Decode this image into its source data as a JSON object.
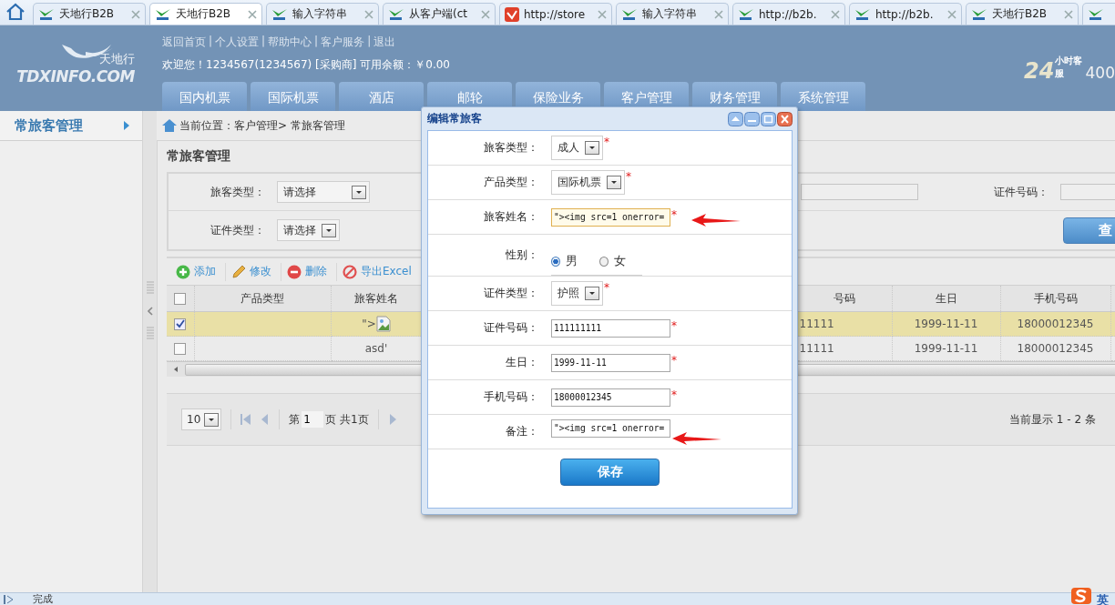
{
  "browser_tabs": [
    {
      "title": "天地行B2B",
      "selected": false
    },
    {
      "title": "天地行B2B",
      "selected": true
    },
    {
      "title": "输入字符串",
      "selected": false
    },
    {
      "title": "从客户端(ct",
      "selected": false
    },
    {
      "title": "http://store",
      "selected": false,
      "kind": "red"
    },
    {
      "title": "输入字符串",
      "selected": false
    },
    {
      "title": "http://b2b.",
      "selected": false
    },
    {
      "title": "http://b2b.",
      "selected": false
    },
    {
      "title": "天地行B2B",
      "selected": false
    },
    {
      "selected": false
    }
  ],
  "header": {
    "logo_text": "TDXINFO.COM",
    "logo_name": "天地行",
    "links": [
      "返回首页",
      "个人设置",
      "帮助中心",
      "客户服务",
      "退出"
    ],
    "link_separator": "|",
    "welcome": "欢迎您！1234567(1234567) [采购商] 可用余额：￥0.00",
    "hotline_mark": "24",
    "hotline_badge": "小时客服",
    "hotline_number": "400"
  },
  "nav_tabs": [
    {
      "label": "国内机票",
      "selected": false
    },
    {
      "label": "国际机票",
      "selected": false
    },
    {
      "label": "酒店",
      "selected": false
    },
    {
      "label": "邮轮",
      "selected": false
    },
    {
      "label": "保险业务",
      "selected": false
    },
    {
      "label": "客户管理",
      "selected": false
    },
    {
      "label": "财务管理",
      "selected": false
    },
    {
      "label": "系统管理",
      "selected": false
    }
  ],
  "sidebar": {
    "items": [
      {
        "label": "常旅客管理"
      }
    ]
  },
  "breadcrumb": "当前位置：客户管理> 常旅客管理",
  "panel_title": "常旅客管理",
  "filters": {
    "passenger_type": {
      "label": "旅客类型：",
      "value": "请选择"
    },
    "id_number": {
      "label": "证件号码："
    },
    "id_type": {
      "label": "证件类型：",
      "value": "请选择"
    },
    "search_button": "查"
  },
  "toolbar": [
    {
      "label": "添加",
      "kind": "add"
    },
    {
      "label": "修改",
      "kind": "edit"
    },
    {
      "label": "删除",
      "kind": "delete"
    },
    {
      "label": "导出Excel",
      "kind": "export"
    }
  ],
  "table": {
    "header_checked": false,
    "columns": [
      {
        "label": "产品类型"
      },
      {
        "label": "旅客姓名"
      },
      {
        "label": "号码"
      },
      {
        "label": "生日"
      },
      {
        "label": "手机号码"
      }
    ],
    "rows": [
      {
        "selected": true,
        "checked": true,
        "name_image": true,
        "cells": [
          "",
          "\">",
          "11111",
          "1999-11-11",
          "18000012345"
        ]
      },
      {
        "selected": false,
        "checked": false,
        "name_image": false,
        "cells": [
          "",
          "asd'",
          "11111",
          "1999-11-11",
          "18000012345"
        ]
      }
    ]
  },
  "pager": {
    "page_size": "10",
    "before": "第",
    "page": "1",
    "after": "页 共1页",
    "summary": "当前显示 1 - 2 条"
  },
  "dialog": {
    "title": "编辑常旅客",
    "required_mark": "*",
    "fields": [
      {
        "label": "旅客类型：",
        "kind": "select",
        "value": "成人",
        "required": true
      },
      {
        "label": "产品类型：",
        "kind": "select",
        "value": "国际机票",
        "required": true
      },
      {
        "label": "旅客姓名：",
        "kind": "input",
        "value": "\"><img src=1 onerror=",
        "required": true,
        "focused": true,
        "annotated": true
      },
      {
        "label": "性别：",
        "kind": "radio",
        "options": [
          {
            "label": "男",
            "selected": true
          },
          {
            "label": "女",
            "selected": false
          }
        ]
      },
      {
        "label": "证件类型：",
        "kind": "select",
        "value": "护照",
        "required": true
      },
      {
        "label": "证件号码：",
        "kind": "input",
        "value": "111111111",
        "required": true
      },
      {
        "label": "生日：",
        "kind": "input",
        "value": "1999-11-11",
        "required": true
      },
      {
        "label": "手机号码：",
        "kind": "input",
        "value": "18000012345",
        "required": true
      },
      {
        "label": "备注：",
        "kind": "input",
        "value": "\"><img src=1 onerror=",
        "required": false,
        "annotated": true
      }
    ],
    "save_button": "保存"
  },
  "status_bar": {
    "text": "完成",
    "ime": "英"
  }
}
